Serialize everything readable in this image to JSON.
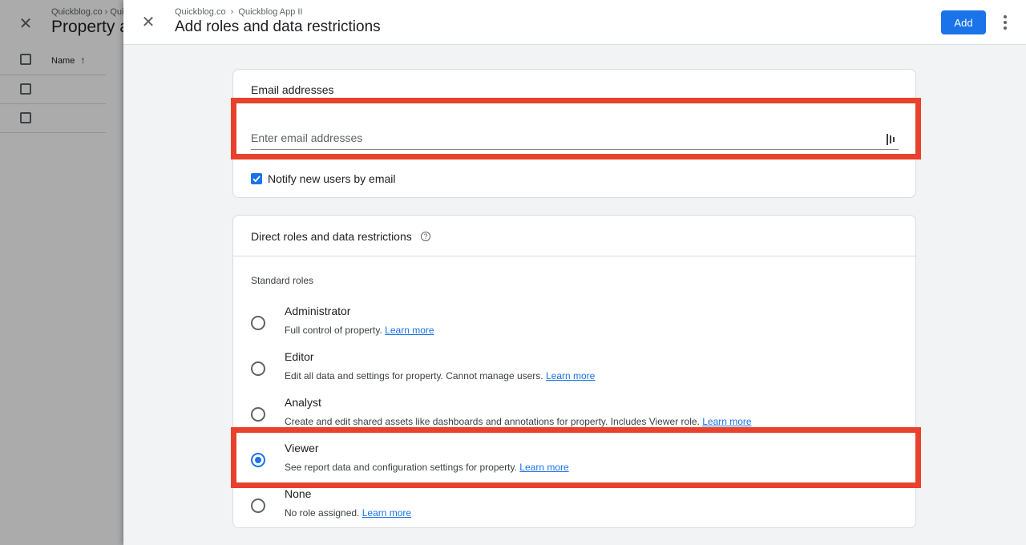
{
  "background_page": {
    "close_icon": "close-icon",
    "breadcrumb": "Quickblog.co › Qui",
    "title": "Property a",
    "column_name": "Name",
    "sort_icon": "arrow-up-icon"
  },
  "panel": {
    "breadcrumb": {
      "account": "Quickblog.co",
      "separator": "›",
      "property": "Quickblog App II"
    },
    "title": "Add roles and data restrictions",
    "add_label": "Add",
    "close_icon": "close-icon",
    "more_icon": "more-vert-icon"
  },
  "email_section": {
    "title": "Email addresses",
    "input_placeholder": "Enter email addresses",
    "input_value": "",
    "contacts_icon": "contacts-icon",
    "notify_label": "Notify new users by email",
    "notify_checked": true
  },
  "roles_section": {
    "title": "Direct roles and data restrictions",
    "help_icon": "help-icon",
    "standard_roles_label": "Standard roles",
    "learn_more": "Learn more",
    "roles": [
      {
        "name": "Administrator",
        "description": "Full control of property.",
        "selected": false
      },
      {
        "name": "Editor",
        "description": "Edit all data and settings for property. Cannot manage users.",
        "selected": false
      },
      {
        "name": "Analyst",
        "description": "Create and edit shared assets like dashboards and annotations for property. Includes Viewer role.",
        "selected": false
      },
      {
        "name": "Viewer",
        "description": "See report data and configuration settings for property.",
        "selected": true
      },
      {
        "name": "None",
        "description": "No role assigned.",
        "selected": false
      }
    ]
  },
  "colors": {
    "accent": "#1a73e8",
    "highlight": "#e8412c",
    "panel_bg": "#f1f3f4"
  }
}
